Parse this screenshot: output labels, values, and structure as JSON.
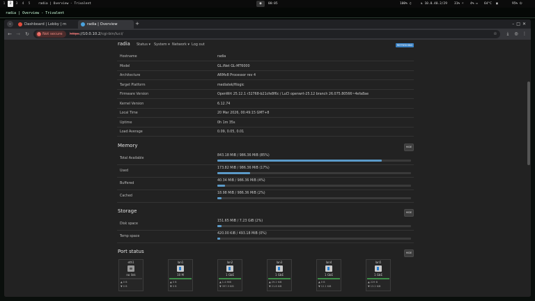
{
  "system_bar": {
    "workspaces": [
      "1",
      "2",
      "3",
      "4",
      "5"
    ],
    "active_workspace": "2",
    "window_title": "radia | Overview - Trivalent",
    "clock": "00:05",
    "volume": "100%",
    "network": "10.0.40.2/29",
    "brightness": "31%",
    "battery": "4%",
    "temp": "64°C",
    "power": "95%"
  },
  "terminal_title": "radia | Overview - Trivalent",
  "browser": {
    "tabs": [
      {
        "label": "Dashboard | Lobby | m",
        "active": false,
        "favicon_color": "#e34c3c"
      },
      {
        "label": "radia | Overview",
        "active": true,
        "favicon_color": "#4aa3df"
      }
    ],
    "new_tab": "+",
    "security_label": "Not secure",
    "url_scheme": "https",
    "url_host": "://10.0.10.2",
    "url_path": "/cgi-bin/luci/"
  },
  "luci": {
    "brand": "radia",
    "menu": [
      "Status ▾",
      "System ▾",
      "Network ▾"
    ],
    "logout": "Log out",
    "refresh_badge": "REFRESHING",
    "system_rows": [
      {
        "key": "Hostname",
        "value": "radia"
      },
      {
        "key": "Model",
        "value": "GL.iNet GL-MT6000"
      },
      {
        "key": "Architecture",
        "value": "ARMv8 Processor rev 4"
      },
      {
        "key": "Target Platform",
        "value": "mediatek/filogic"
      },
      {
        "key": "Firmware Version",
        "value": "OpenWrt 25.12.1 r32768-b21cfe8f6c / LuCI openwrt-25.12 branch 26.075.80566~4efa8ae"
      },
      {
        "key": "Kernel Version",
        "value": "6.12.74"
      },
      {
        "key": "Local Time",
        "value": "20 Mar 2026, 00:49:15 GMT+8"
      },
      {
        "key": "Uptime",
        "value": "0h 1m 35s"
      },
      {
        "key": "Load Average",
        "value": "0.09, 0.05, 0.01"
      }
    ],
    "memory_title": "Memory",
    "hide_label": "HIDE",
    "memory_rows": [
      {
        "key": "Total Available",
        "text": "843.18 MiB / 986.36 MiB (85%)",
        "percent": 85
      },
      {
        "key": "Used",
        "text": "173.82 MiB / 986.36 MiB (17%)",
        "percent": 17
      },
      {
        "key": "Buffered",
        "text": "40.34 MiB / 986.36 MiB (4%)",
        "percent": 4
      },
      {
        "key": "Cached",
        "text": "18.98 MiB / 986.36 MiB (2%)",
        "percent": 2
      }
    ],
    "storage_title": "Storage",
    "storage_rows": [
      {
        "key": "Disk space",
        "text": "151.65 MiB / 7.23 GiB (2%)",
        "percent": 2
      },
      {
        "key": "Temp space",
        "text": "420.00 KiB / 493.18 MiB (0%)",
        "percent": 0
      }
    ],
    "port_title": "Port status",
    "ports": [
      {
        "name": "eth1",
        "speed": "no link",
        "up": false,
        "tx": "▲ 0 B",
        "rx": "▼ 0 B"
      },
      {
        "name": "lan1",
        "speed": "10 M",
        "up": true,
        "tx": "▲ 0 B",
        "rx": "▼ 0 B"
      },
      {
        "name": "lan2",
        "speed": "1 GbE",
        "up": true,
        "tx": "▲ 1.4 MiB",
        "rx": "▼ 397.9 KiB"
      },
      {
        "name": "lan3",
        "speed": "1 GbE",
        "up": true,
        "tx": "▲ 29.2 KiB",
        "rx": "▼ 21.8 KiB"
      },
      {
        "name": "lan4",
        "speed": "1 GbE",
        "up": true,
        "tx": "▲ 0 B",
        "rx": "▼ 12.1 KiB"
      },
      {
        "name": "lan5",
        "speed": "1 GbE",
        "up": true,
        "tx": "▲ 229 B",
        "rx": "▼ 13.2 KiB"
      }
    ]
  }
}
